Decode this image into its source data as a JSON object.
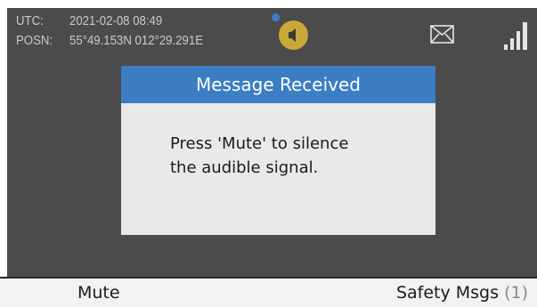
{
  "status_bar": {
    "utc_label": "UTC:",
    "utc_value": "2021-02-08  08:49",
    "posn_label": "POSN:",
    "posn_value": "55°49.153N  012°29.291E",
    "icons": {
      "led": "status-led-icon",
      "speaker": "speaker-icon",
      "mail": "envelope-icon",
      "signal": "signal-strength-icon"
    }
  },
  "dialog": {
    "title": "Message Received",
    "line1": "Press 'Mute' to silence",
    "line2": "the audible signal."
  },
  "softkeys": {
    "left_label": "Mute",
    "right_label": "Safety Msgs",
    "right_count": "(1)"
  },
  "colors": {
    "display_background": "#4b4b4b",
    "dialog_header": "#3b7ec4",
    "dialog_body": "#e9e9e9",
    "speaker_indicator": "#c9a83a",
    "led": "#3d7ac7",
    "softkey_bar": "#f2f2f2"
  }
}
